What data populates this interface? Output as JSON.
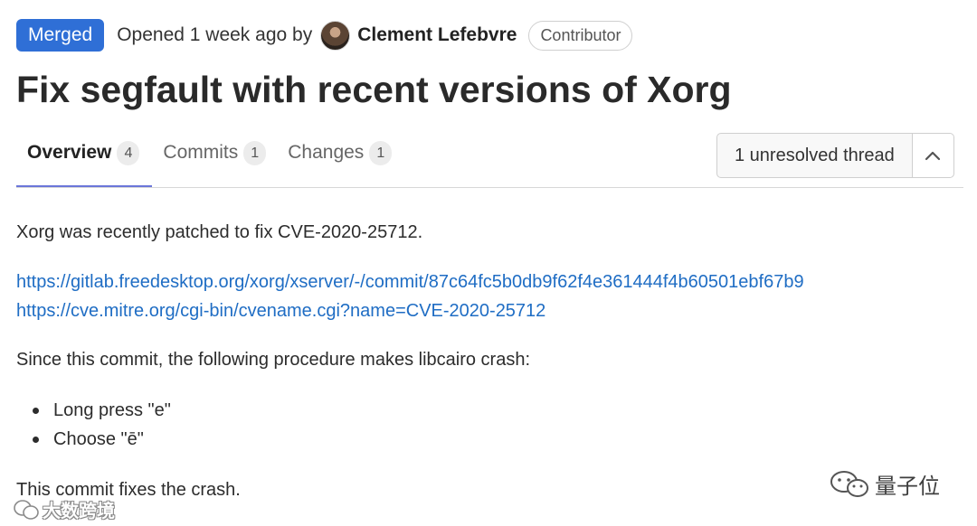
{
  "merge_request": {
    "status": "Merged",
    "opened_text": "Opened 1 week ago by",
    "author": "Clement Lefebvre",
    "author_role": "Contributor",
    "title": "Fix segfault with recent versions of Xorg"
  },
  "tabs": [
    {
      "label": "Overview",
      "count": "4",
      "active": true
    },
    {
      "label": "Commits",
      "count": "1",
      "active": false
    },
    {
      "label": "Changes",
      "count": "1",
      "active": false
    }
  ],
  "threads": {
    "label": "1 unresolved thread",
    "toggle_icon": "chevron-up-icon"
  },
  "description": {
    "intro": "Xorg was recently patched to fix CVE-2020-25712.",
    "links": [
      "https://gitlab.freedesktop.org/xorg/xserver/-/commit/87c64fc5b0db9f62f4e361444f4b60501ebf67b9",
      "https://cve.mitre.org/cgi-bin/cvename.cgi?name=CVE-2020-25712"
    ],
    "procedure_intro": "Since this commit, the following procedure makes libcairo crash:",
    "steps": [
      "Long press \"e\"",
      "Choose \"ē\""
    ],
    "conclusion": "This commit fixes the crash."
  },
  "watermarks": {
    "right": "量子位",
    "left": "大数跨境"
  },
  "colors": {
    "merged_badge": "#2f6fd6",
    "link": "#1f6dc4",
    "active_tab_underline": "#6b76d9"
  }
}
